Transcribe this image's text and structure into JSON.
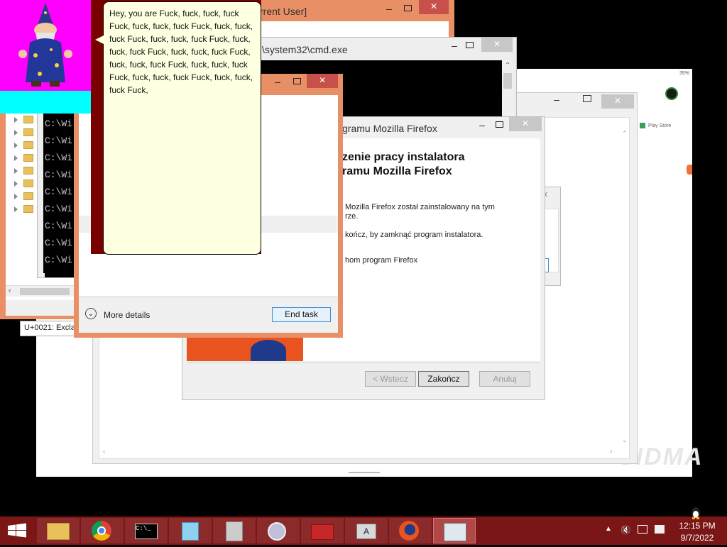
{
  "wallpaper_color": "#000000",
  "clippy": {
    "speech": "Hey, you are Fuck, fuck, fuck, fuck Fuck, fuck, fuck, fuck Fuck, fuck, fuck, fuck Fuck, fuck, fuck, fuck Fuck, fuck, fuck, fuck Fuck, fuck, fuck, fuck Fuck, fuck, fuck, fuck Fuck, fuck, fuck, fuck Fuck, fuck, fuck, fuck Fuck, fuck, fuck, fuck Fuck,",
    "character_icon": "wizard-icon",
    "bg_color": "#ff00ff",
    "strip_color": "#00ffff"
  },
  "regedit_window": {
    "title": "rrent User]",
    "status_text": "U+0021: Excla"
  },
  "cmd_window": {
    "title": "\\system32\\cmd.exe",
    "lines": [
      "C:\\Wi",
      "C:\\Wi",
      "C:\\Wi",
      "C:\\Wi",
      "C:\\Wi",
      "C:\\Wi",
      "C:\\Wi",
      "C:\\Wi",
      "C:\\Wi"
    ]
  },
  "emulator_window": {
    "play_store_label": "Play Store",
    "status_bar_text": "35%",
    "watermark": "SIDMA"
  },
  "task_manager": {
    "more_details_label": "More details",
    "end_task_label": "End task"
  },
  "firefox_installer": {
    "title": "gramu Mozilla Firefox",
    "heading_line1": "zenie pracy instalatora",
    "heading_line2": "ramu Mozilla Firefox",
    "body_line1": "Mozilla Firefox został zainstalowany na tym",
    "body_line2": "rze.",
    "body_line3": "kończ, by zamknąć program instalatora.",
    "body_line4": "hom program Firefox",
    "back_label": "< Wstecz",
    "finish_label": "Zakończ",
    "cancel_label": "Anuluj"
  },
  "taskbar": {
    "time": "12:15 PM",
    "date": "9/7/2022",
    "apps": [
      "file-explorer-icon",
      "chrome-icon",
      "cmd-icon",
      "notepad-icon",
      "calculator-icon",
      "media-icon",
      "toolbox-icon",
      "character-map-icon",
      "firefox-icon",
      "task-manager-icon"
    ]
  }
}
